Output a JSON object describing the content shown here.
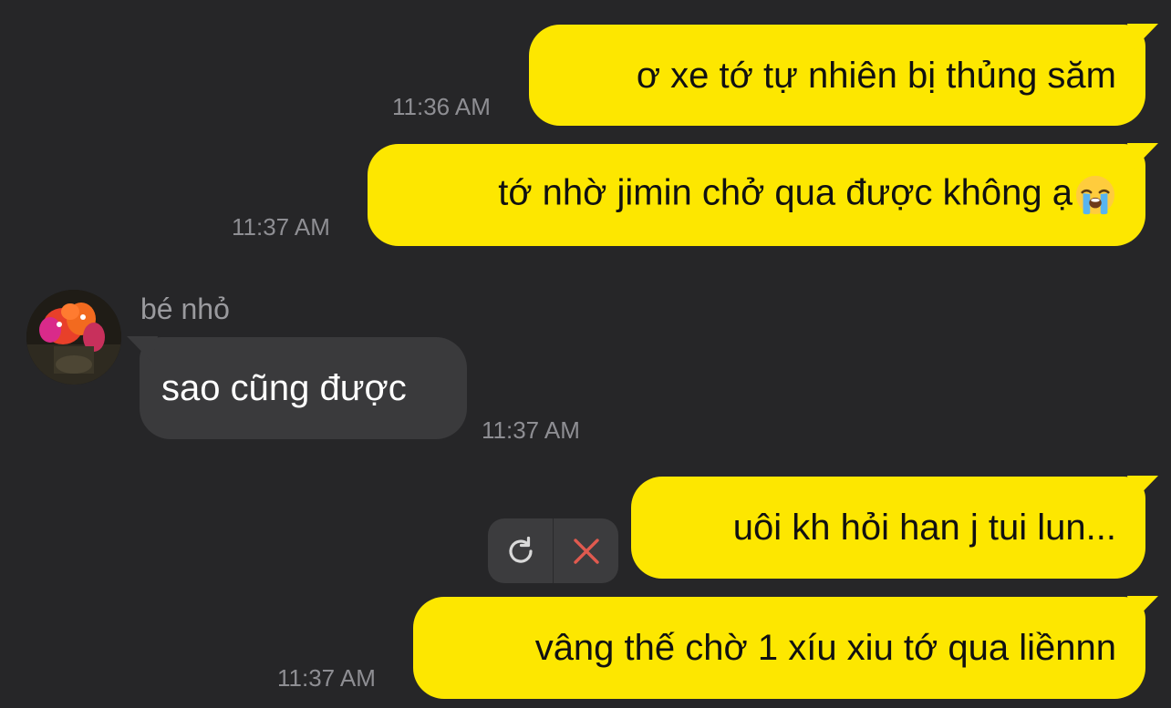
{
  "messages": [
    {
      "side": "out",
      "text": "ơ xe tớ tự nhiên bị thủng săm",
      "time": "11:36 AM"
    },
    {
      "side": "out",
      "text": "tớ nhờ jimin chở qua được không ạ",
      "emoji": "loudly-crying-face",
      "time": "11:37 AM"
    },
    {
      "side": "in",
      "sender": "bé nhỏ",
      "text": "sao cũng được",
      "time": "11:37 AM"
    },
    {
      "side": "out",
      "text": "uôi kh hỏi han j tui lun...",
      "status": "failed"
    },
    {
      "side": "out",
      "text": "vâng thế chờ 1 xíu xiu tớ qua liềnnn",
      "time": "11:37 AM"
    }
  ],
  "icons": {
    "retry": "refresh-icon",
    "delete": "close-icon",
    "emoji": "loudly-crying-face-icon"
  },
  "colors": {
    "background": "#262628",
    "outgoing_bubble": "#fde700",
    "incoming_bubble": "#3a3a3c",
    "timestamp": "#8e8e93",
    "delete_icon": "#e05a4f",
    "retry_icon": "#d9d9d9"
  }
}
